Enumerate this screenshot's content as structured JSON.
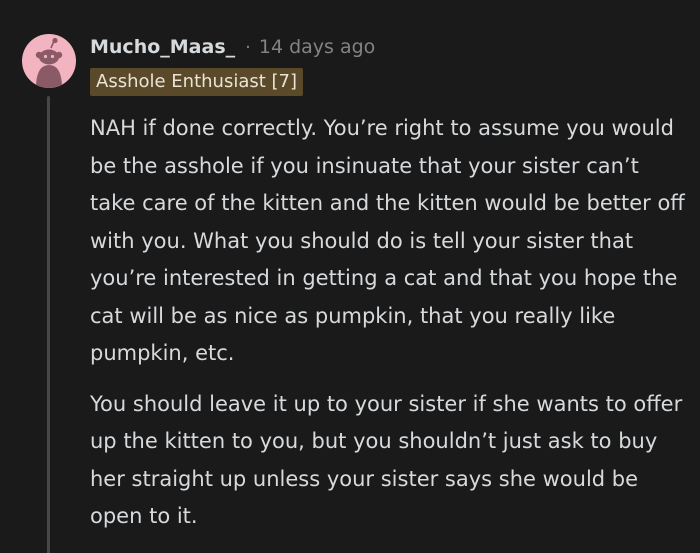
{
  "comment": {
    "username": "Mucho_Maas_",
    "separator": "·",
    "timestamp": "14 days ago",
    "flair": "Asshole Enthusiast [7]",
    "avatar_icon": "snoo-avatar-icon",
    "avatar_color": "#f3b4c1",
    "paragraphs": [
      "NAH if done correctly. You’re right to assume you would be the asshole if you insinuate that your sister can’t take care of the kitten and the kitten would be better off with you. What you should do is tell your sister that you’re interested in getting a cat and that you hope the cat will be as nice as pumpkin, that you really like pumpkin, etc.",
      "You should leave it up to your sister if she wants to offer up the kitten to you, but you shouldn’t just ask to buy her straight up unless your sister says she would be open to it."
    ]
  }
}
